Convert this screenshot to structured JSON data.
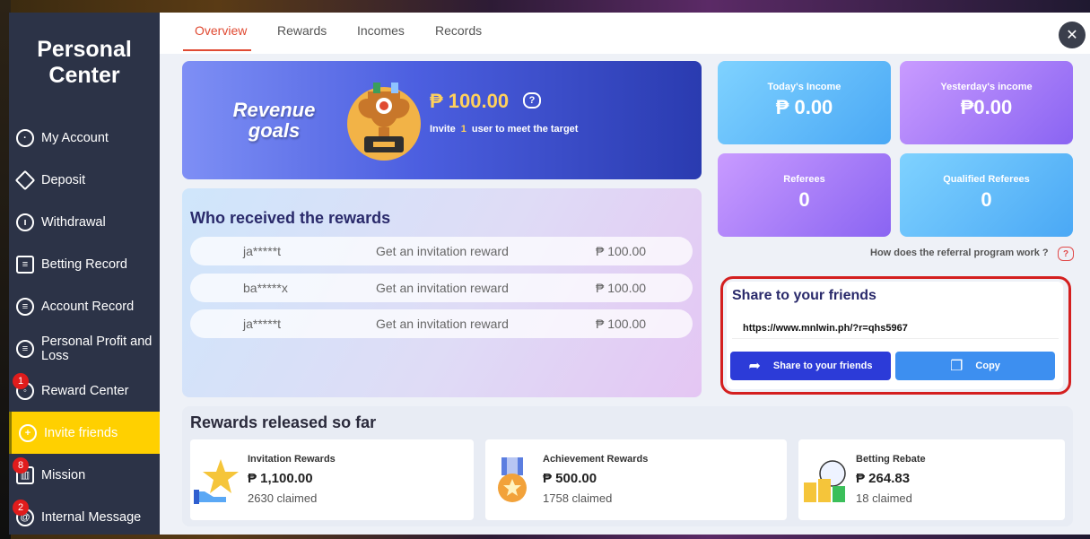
{
  "sidebar": {
    "title_line1": "Personal",
    "title_line2": "Center",
    "items": [
      {
        "label": "My Account",
        "icon": "user-circle-icon"
      },
      {
        "label": "Deposit",
        "icon": "deposit-icon"
      },
      {
        "label": "Withdrawal",
        "icon": "withdrawal-icon"
      },
      {
        "label": "Betting Record",
        "icon": "document-icon"
      },
      {
        "label": "Account Record",
        "icon": "ledger-icon"
      },
      {
        "label": "Personal Profit and Loss",
        "icon": "profit-loss-icon"
      },
      {
        "label": "Reward Center",
        "icon": "globe-icon",
        "badge": "1"
      },
      {
        "label": "Invite friends",
        "icon": "invite-friends-icon",
        "active": true
      },
      {
        "label": "Mission",
        "icon": "gift-icon",
        "badge": "8"
      },
      {
        "label": "Internal Message",
        "icon": "at-icon",
        "badge": "2"
      }
    ]
  },
  "tabs": {
    "overview": "Overview",
    "rewards": "Rewards",
    "incomes": "Incomes",
    "records": "Records"
  },
  "revenue": {
    "title_line1": "Revenue",
    "title_line2": "goals",
    "amount": "₱ 100.00",
    "invite_prefix": "Invite",
    "invite_count": "1",
    "invite_suffix": "user to meet the target"
  },
  "who": {
    "title": "Who received the rewards",
    "rows": [
      {
        "user": "ja*****t",
        "desc": "Get an invitation reward",
        "amount": "₱ 100.00"
      },
      {
        "user": "ba*****x",
        "desc": "Get an invitation reward",
        "amount": "₱ 100.00"
      },
      {
        "user": "ja*****t",
        "desc": "Get an invitation reward",
        "amount": "₱ 100.00"
      }
    ]
  },
  "stats": {
    "today_label": "Today's Income",
    "today_value": "₱ 0.00",
    "yesterday_label": "Yesterday's income",
    "yesterday_value": "₱0.00",
    "referees_label": "Referees",
    "referees_value": "0",
    "qualified_label": "Qualified Referees",
    "qualified_value": "0"
  },
  "how": {
    "text": "How does the referral program work ?"
  },
  "share": {
    "title": "Share to your friends",
    "link": "https://www.mnlwin.ph/?r=qhs5967",
    "share_button": "Share to your friends",
    "copy_button": "Copy"
  },
  "released": {
    "title": "Rewards released so far",
    "cards": [
      {
        "label": "Invitation Rewards",
        "amount": "₱ 1,100.00",
        "claimed": "2630 claimed"
      },
      {
        "label": "Achievement Rewards",
        "amount": "₱ 500.00",
        "claimed": "1758 claimed"
      },
      {
        "label": "Betting Rebate",
        "amount": "₱ 264.83",
        "claimed": "18 claimed"
      }
    ]
  },
  "colors": {
    "accent": "#e04a32",
    "sidebar_bg": "#2c3347",
    "active_nav": "#ffd000",
    "share_outline": "#d41f1f"
  }
}
